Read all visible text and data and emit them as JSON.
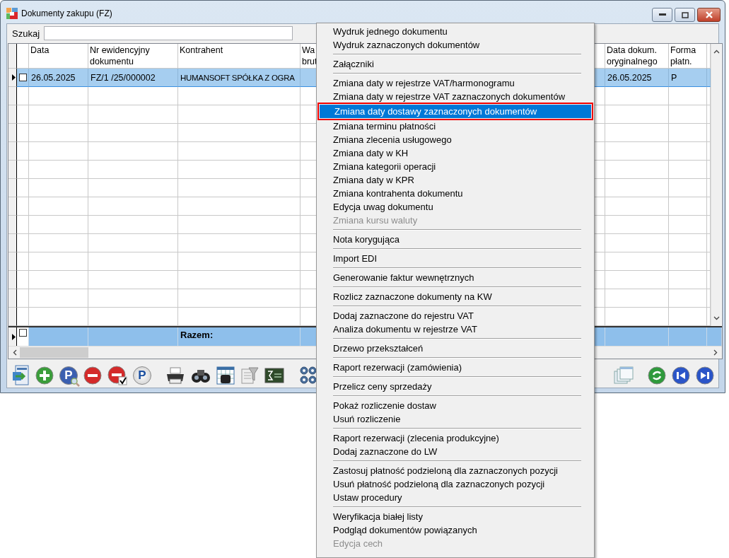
{
  "window": {
    "title": "Dokumenty zakupu (FZ)"
  },
  "search": {
    "label": "Szukaj"
  },
  "table": {
    "columns": [
      {
        "lines": [
          "Data"
        ]
      },
      {
        "lines": [
          "Nr ewidencyjny",
          "dokumentu"
        ]
      },
      {
        "lines": [
          "Kontrahent"
        ]
      },
      {
        "lines": [
          "Wa",
          "brut"
        ]
      },
      {
        "lines": [
          "Data dokum.",
          "oryginalnego"
        ]
      },
      {
        "lines": [
          "Forma",
          "płatn."
        ]
      }
    ],
    "rows": [
      {
        "selected": true,
        "checked": false,
        "date": "26.05.2025",
        "number": "FZ/1  /25/000002",
        "contractor": "HUMANSOFT SPÓŁKA Z OGRA",
        "original_date": "26.05.2025",
        "payment_form": "P"
      }
    ],
    "footer": {
      "label": "Razem:",
      "checked": false
    }
  },
  "toolbar_left": [
    {
      "kind": "export"
    },
    {
      "kind": "add"
    },
    {
      "kind": "preview",
      "glyph": "P"
    },
    {
      "kind": "remove"
    },
    {
      "kind": "remove-checked"
    },
    {
      "kind": "post",
      "glyph": "P"
    },
    {
      "kind": "print"
    },
    {
      "kind": "find"
    },
    {
      "kind": "grid-find"
    },
    {
      "kind": "filter"
    },
    {
      "kind": "formula"
    },
    {
      "kind": "gears"
    }
  ],
  "toolbar_right": [
    {
      "kind": "windows"
    },
    {
      "kind": "refresh"
    },
    {
      "kind": "first"
    },
    {
      "kind": "last"
    }
  ],
  "context_menu": {
    "groups": [
      [
        {
          "label": "Wydruk jednego dokumentu",
          "disabled": false,
          "selected": false
        },
        {
          "label": "Wydruk zaznaczonych dokumentów",
          "disabled": false,
          "selected": false
        }
      ],
      [
        {
          "label": "Załączniki",
          "disabled": false,
          "selected": false
        }
      ],
      [
        {
          "label": "Zmiana daty w rejestrze VAT/harmonogramu",
          "disabled": false,
          "selected": false
        },
        {
          "label": "Zmiana daty w rejestrze VAT zaznaczonych dokumentów",
          "disabled": false,
          "selected": false
        },
        {
          "label": "Zmiana daty dostawy zaznaczonych dokumentów",
          "disabled": false,
          "selected": true
        },
        {
          "label": "Zmiana terminu płatności",
          "disabled": false,
          "selected": false
        },
        {
          "label": "Zmiana zlecenia usługowego",
          "disabled": false,
          "selected": false
        },
        {
          "label": "Zmiana daty w KH",
          "disabled": false,
          "selected": false
        },
        {
          "label": "Zmiana kategorii operacji",
          "disabled": false,
          "selected": false
        },
        {
          "label": "Zmiana daty w KPR",
          "disabled": false,
          "selected": false
        },
        {
          "label": "Zmiana kontrahenta dokumentu",
          "disabled": false,
          "selected": false
        },
        {
          "label": "Edycja uwag dokumentu",
          "disabled": false,
          "selected": false
        },
        {
          "label": "Zmiana kursu waluty",
          "disabled": true,
          "selected": false
        }
      ],
      [
        {
          "label": "Nota korygująca",
          "disabled": false,
          "selected": false
        }
      ],
      [
        {
          "label": "Import EDI",
          "disabled": false,
          "selected": false
        }
      ],
      [
        {
          "label": "Generowanie faktur wewnętrznych",
          "disabled": false,
          "selected": false
        }
      ],
      [
        {
          "label": "Rozlicz zaznaczone dokumenty na KW",
          "disabled": false,
          "selected": false
        }
      ],
      [
        {
          "label": "Dodaj zaznaczone do rejestru VAT",
          "disabled": false,
          "selected": false
        },
        {
          "label": "Analiza dokumentu w rejestrze VAT",
          "disabled": false,
          "selected": false
        }
      ],
      [
        {
          "label": "Drzewo przekształceń",
          "disabled": false,
          "selected": false
        }
      ],
      [
        {
          "label": "Raport rezerwacji (zamówienia)",
          "disabled": false,
          "selected": false
        }
      ],
      [
        {
          "label": "Przelicz ceny sprzedaży",
          "disabled": false,
          "selected": false
        }
      ],
      [
        {
          "label": "Pokaż rozliczenie dostaw",
          "disabled": false,
          "selected": false
        },
        {
          "label": "Usuń rozliczenie",
          "disabled": false,
          "selected": false
        }
      ],
      [
        {
          "label": "Raport rezerwacji (zlecenia produkcyjne)",
          "disabled": false,
          "selected": false
        },
        {
          "label": "Dodaj zaznaczone do LW",
          "disabled": false,
          "selected": false
        }
      ],
      [
        {
          "label": "Zastosuj płatność podzieloną dla zaznaczonych pozycji",
          "disabled": false,
          "selected": false
        },
        {
          "label": "Usuń płatność podzieloną dla zaznaczonych pozycji",
          "disabled": false,
          "selected": false
        },
        {
          "label": "Ustaw procedury",
          "disabled": false,
          "selected": false
        }
      ],
      [
        {
          "label": "Weryfikacja białej listy",
          "disabled": false,
          "selected": false
        },
        {
          "label": "Podgląd dokumentów powiązanych",
          "disabled": false,
          "selected": false
        },
        {
          "label": "Edycja cech",
          "disabled": true,
          "selected": false
        }
      ]
    ]
  }
}
